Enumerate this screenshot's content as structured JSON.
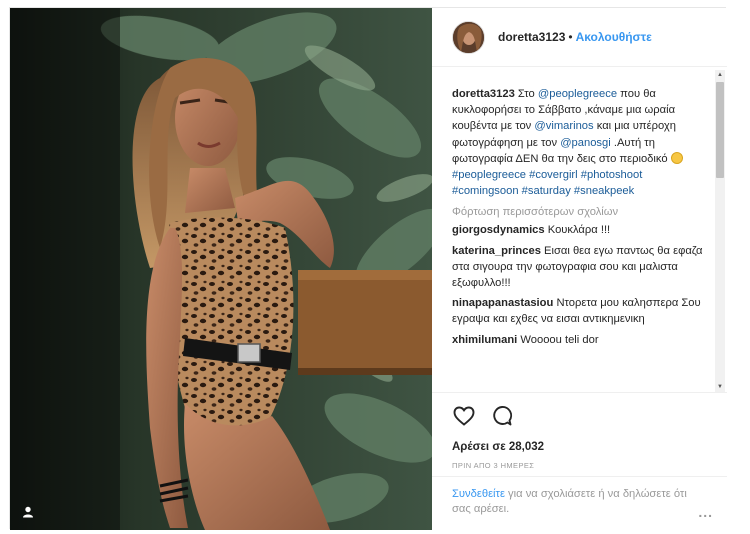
{
  "header": {
    "username": "doretta3123",
    "dot": "•",
    "follow_label": "Ακολουθήστε"
  },
  "caption": {
    "username": "doretta3123",
    "text_1": " Στο ",
    "mention_1": "@peoplegreece",
    "text_2": " που θα κυκλοφορήσει το Σάββατο ,κάναμε μια ωραία κουβέντα με τον ",
    "mention_2": "@vimarinos",
    "text_3": " και μια υπέροχη φωτογράφηση με τον ",
    "mention_3": "@panosgi",
    "text_4": " .Αυτή τη φωτογραφία ΔΕΝ θα την δεις στο περιοδικό ",
    "text_5": " ",
    "hashtags": [
      "#peoplegreece",
      "#covergirl",
      "#photoshoot",
      "#comingsoon",
      "#saturday",
      "#sneakpeek"
    ]
  },
  "load_more_label": "Φόρτωση περισσότερων σχολίων",
  "comments": [
    {
      "user": "giorgosdynamics",
      "text": "Κουκλάρα !!!"
    },
    {
      "user": "katerina_princes",
      "text": "Εισαι θεα εγω παντως θα εφαζα στα σιγουρα την φωτογραφια σου και μαλιστα εξωφυλλο!!!"
    },
    {
      "user": "ninapapanastasiou",
      "text": "Ντορετα μου καλησπερα Σου εγραψα και εχθες να εισαι αντικημενικη"
    },
    {
      "user": "xhimilumani",
      "text": "Woooou teli dor"
    }
  ],
  "likes_label": "Αρέσει σε 28,032",
  "time_label": "ΠΡΙΝ ΑΠΟ 3 ΗΜΕΡΕΣ",
  "login": {
    "link_label": "Συνδεθείτε",
    "rest_label": " για να σχολιάσετε ή να δηλώσετε ότι σας αρέσει.",
    "more_label": "..."
  },
  "icons": {
    "like": "heart-icon",
    "comment": "comment-bubble-icon",
    "user_tag": "person-icon",
    "scroll_up": "▲",
    "scroll_down": "▼"
  },
  "colors": {
    "link": "#3897f0",
    "mention": "#1b5c98",
    "muted": "#999999",
    "text": "#262626"
  }
}
